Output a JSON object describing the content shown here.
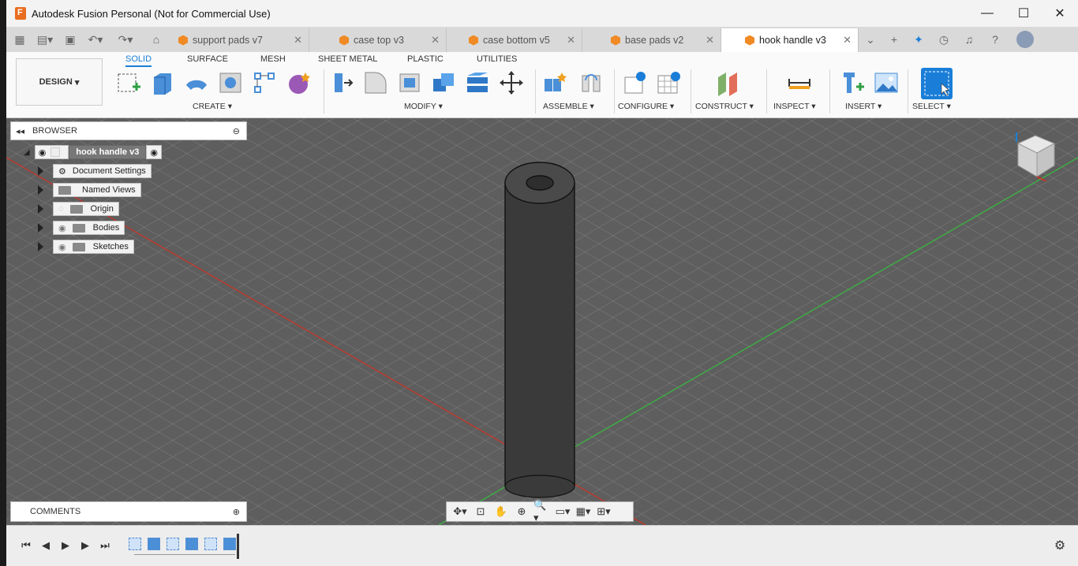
{
  "app": {
    "title": "Autodesk Fusion Personal (Not for Commercial Use)"
  },
  "window_controls": {
    "minimize": "—",
    "maximize": "☐",
    "close": "✕"
  },
  "tabs": [
    {
      "label": "support pads v7",
      "active": false
    },
    {
      "label": "case top v3",
      "active": false
    },
    {
      "label": "case bottom v5",
      "active": false
    },
    {
      "label": "base pads v2",
      "active": false
    },
    {
      "label": "hook handle v3",
      "active": true
    }
  ],
  "toolbar": {
    "workspace": "DESIGN",
    "workspace_tabs": [
      "SOLID",
      "SURFACE",
      "MESH",
      "SHEET METAL",
      "PLASTIC",
      "UTILITIES"
    ],
    "groups": [
      "CREATE",
      "MODIFY",
      "ASSEMBLE",
      "CONFIGURE",
      "CONSTRUCT",
      "INSPECT",
      "INSERT",
      "SELECT"
    ]
  },
  "browser": {
    "title": "BROWSER",
    "root": "hook handle v3",
    "items": [
      "Document Settings",
      "Named Views",
      "Origin",
      "Bodies",
      "Sketches"
    ]
  },
  "comments": {
    "title": "COMMENTS"
  },
  "colors": {
    "accent": "#1a7ed8",
    "viewport": "#5e5e5e",
    "x_axis": "#c0392b",
    "y_axis": "#3cb043",
    "body": "#3a3a3a"
  }
}
